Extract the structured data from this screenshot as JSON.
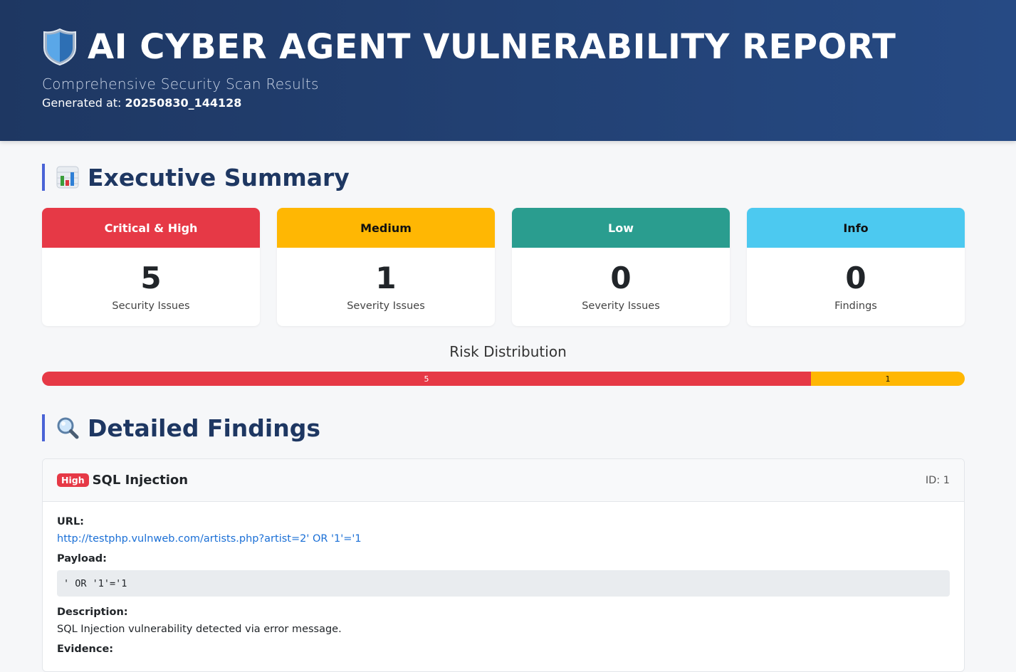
{
  "header": {
    "title": "AI CYBER AGENT VULNERABILITY REPORT",
    "subtitle": "Comprehensive Security Scan Results",
    "generated_label": "Generated at: ",
    "generated_value": "20250830_144128"
  },
  "summary": {
    "heading": "Executive Summary",
    "cards": [
      {
        "title": "Critical & High",
        "count": "5",
        "label": "Security Issues",
        "color": "#e63946",
        "text_color": "#ffffff"
      },
      {
        "title": "Medium",
        "count": "1",
        "label": "Severity Issues",
        "color": "#ffb703",
        "text_color": "#111111"
      },
      {
        "title": "Low",
        "count": "0",
        "label": "Severity Issues",
        "color": "#2a9d8f",
        "text_color": "#ffffff"
      },
      {
        "title": "Info",
        "count": "0",
        "label": "Findings",
        "color": "#4cc9f0",
        "text_color": "#111111"
      }
    ]
  },
  "risk": {
    "title": "Risk Distribution",
    "segments": [
      {
        "value": "5",
        "fraction": 0.8333,
        "color": "#e63946",
        "text_color": "#ffffff"
      },
      {
        "value": "1",
        "fraction": 0.1667,
        "color": "#ffb703",
        "text_color": "#111111"
      }
    ]
  },
  "findings": {
    "heading": "Detailed Findings",
    "items": [
      {
        "severity": "High",
        "title": "SQL Injection",
        "id": "ID: 1",
        "url_label": "URL:",
        "url": "http://testphp.vulnweb.com/artists.php?artist=2' OR '1'='1",
        "payload_label": "Payload:",
        "payload": "' OR '1'='1",
        "description_label": "Description:",
        "description": "SQL Injection vulnerability detected via error message.",
        "evidence_label": "Evidence:"
      }
    ]
  }
}
